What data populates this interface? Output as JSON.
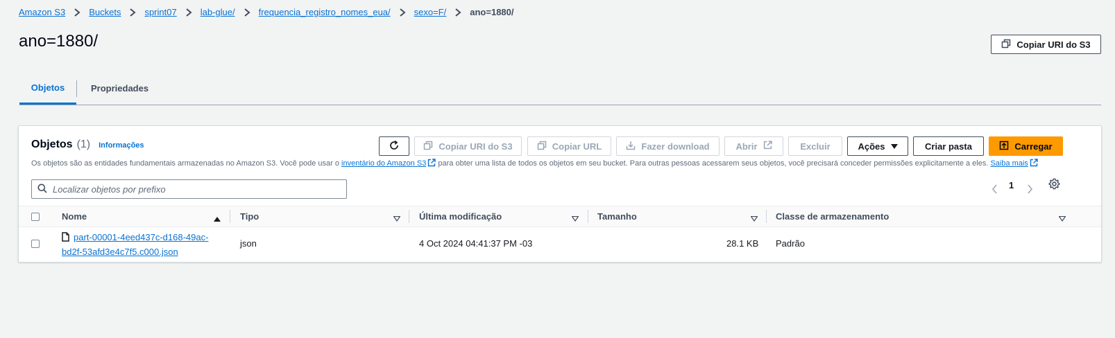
{
  "breadcrumbs": [
    "Amazon S3",
    "Buckets",
    "sprint07",
    "lab-glue/",
    "frequencia_registro_nomes_eua/",
    "sexo=F/",
    "ano=1880/"
  ],
  "page_title": "ano=1880/",
  "header_actions": {
    "copy_s3_uri": "Copiar URI do S3"
  },
  "tabs": [
    {
      "label": "Objetos",
      "active": true
    },
    {
      "label": "Propriedades",
      "active": false
    }
  ],
  "objects_panel": {
    "title": "Objetos",
    "count": "(1)",
    "info_link": "Informações",
    "description_prefix": "Os objetos são as entidades fundamentais armazenadas no Amazon S3. Você pode usar o ",
    "description_link": "inventário do Amazon S3",
    "description_middle": " para obter uma lista de todos os objetos em seu bucket. Para outras pessoas acessarem seus objetos, você precisará conceder permissões explicitamente a eles. ",
    "learn_more": "Saiba mais",
    "toolbar": {
      "copy_uri": "Copiar URI do S3",
      "copy_url": "Copiar URL",
      "download": "Fazer download",
      "open": "Abrir",
      "delete": "Excluir",
      "actions": "Ações",
      "create_folder": "Criar pasta",
      "upload": "Carregar"
    },
    "search_placeholder": "Localizar objetos por prefixo",
    "page": "1",
    "columns": [
      "Nome",
      "Tipo",
      "Última modificação",
      "Tamanho",
      "Classe de armazenamento"
    ],
    "rows": [
      {
        "name_line1": "part-00001-4eed437c-d168-49ac-",
        "name_line2": "bd2f-53afd3e4c7f5.c000.json",
        "type": "json",
        "last_modified": "4 Oct 2024 04:41:37 PM -03",
        "size": "28.1 KB",
        "storage_class": "Padrão"
      }
    ]
  },
  "colors": {
    "link": "#0972d3",
    "primary_button": "#ff9900",
    "background": "#f2f3f3"
  }
}
